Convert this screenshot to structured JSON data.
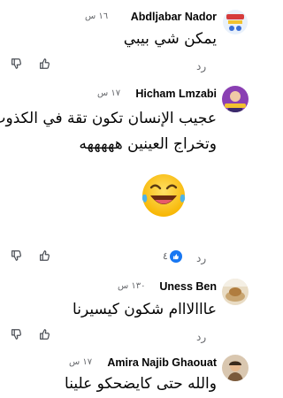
{
  "comments": [
    {
      "author": "Abdljabar Nador",
      "time": "١٦ س",
      "text_lines": [
        "يمكن شي بيبي"
      ],
      "reply_label": "رد"
    },
    {
      "author": "Hicham Lmzabi",
      "time": "١٧ س",
      "text_lines": [
        "عجيب الإنسان تكون تقة في الكذوب",
        "وتخراج العينين هههههه"
      ],
      "reply_label": "رد",
      "reaction_count": "٤",
      "reaction_type": "like",
      "attachment": "laughing-crying-emoji"
    },
    {
      "author": "Uness Ben",
      "time": "١٣٠ س",
      "text_lines": [
        "عااالااام شكون كيسيرنا"
      ],
      "reply_label": "رد"
    },
    {
      "author": "Amira Najib Ghaouat",
      "time": "١٧ س",
      "text_lines": [
        "والله حتى كايضحكو علينا"
      ]
    }
  ],
  "colors": {
    "like_blue": "#1877f2",
    "meta_gray": "#65676b",
    "text": "#050505",
    "emoji_yellow": "#ffcc33",
    "tear_blue": "#4fb3e8"
  },
  "icons": {
    "dislike": "thumbs-down-icon",
    "like": "thumbs-up-icon",
    "like_reaction": "like-reaction-icon"
  }
}
